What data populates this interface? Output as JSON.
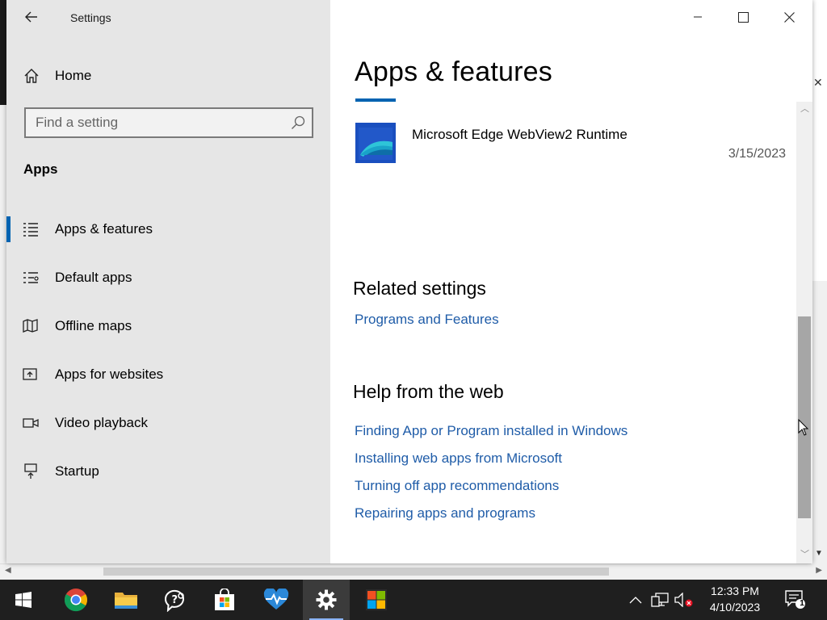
{
  "window": {
    "title": "Settings"
  },
  "sidebar": {
    "home_label": "Home",
    "search_placeholder": "Find a setting",
    "section_label": "Apps",
    "items": [
      {
        "label": "Apps & features",
        "icon": "apps-features-icon",
        "active": true
      },
      {
        "label": "Default apps",
        "icon": "default-apps-icon",
        "active": false
      },
      {
        "label": "Offline maps",
        "icon": "offline-maps-icon",
        "active": false
      },
      {
        "label": "Apps for websites",
        "icon": "apps-for-websites-icon",
        "active": false
      },
      {
        "label": "Video playback",
        "icon": "video-playback-icon",
        "active": false
      },
      {
        "label": "Startup",
        "icon": "startup-icon",
        "active": false
      }
    ]
  },
  "main": {
    "page_title": "Apps & features",
    "app": {
      "name": "Microsoft Edge WebView2 Runtime",
      "date": "3/15/2023",
      "icon": "edge-webview-icon"
    },
    "related_settings": {
      "heading": "Related settings",
      "links": [
        "Programs and Features"
      ]
    },
    "help": {
      "heading": "Help from the web",
      "links": [
        "Finding App or Program installed in Windows",
        "Installing web apps from Microsoft",
        "Turning off app recommendations",
        "Repairing apps and programs"
      ]
    }
  },
  "taskbar": {
    "apps": [
      "windows-start-icon",
      "chrome-icon",
      "file-explorer-icon",
      "feedback-hub-icon",
      "microsoft-store-icon",
      "health-app-icon",
      "settings-icon",
      "microsoft-app-icon"
    ],
    "active_app": "settings-icon",
    "time": "12:33 PM",
    "date": "4/10/2023",
    "notification_count": "1"
  },
  "colors": {
    "accent": "#0063b1",
    "link": "#1f5ca8",
    "sidebar_bg": "#e6e6e6",
    "taskbar_bg": "#1f1f1f"
  }
}
